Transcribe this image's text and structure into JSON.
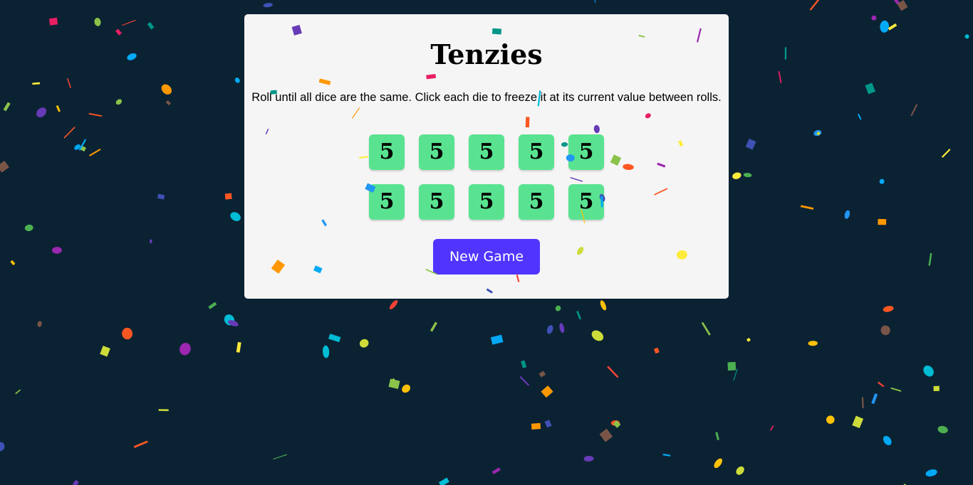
{
  "game": {
    "title": "Tenzies",
    "instructions": "Roll until all dice are the same. Click each die to freeze it at its current value between rolls.",
    "dice": [
      {
        "value": "5",
        "held": true
      },
      {
        "value": "5",
        "held": true
      },
      {
        "value": "5",
        "held": true
      },
      {
        "value": "5",
        "held": true
      },
      {
        "value": "5",
        "held": true
      },
      {
        "value": "5",
        "held": true
      },
      {
        "value": "5",
        "held": true
      },
      {
        "value": "5",
        "held": true
      },
      {
        "value": "5",
        "held": true
      },
      {
        "value": "5",
        "held": true
      }
    ],
    "button_label": "New Game",
    "state": "won"
  },
  "colors": {
    "background": "#0b2233",
    "board": "#f5f5f5",
    "die_held": "#59e391",
    "button": "#5035ff",
    "button_text": "#ffffff"
  },
  "confetti": {
    "active": true,
    "palette": [
      "#f44336",
      "#e91e63",
      "#9c27b0",
      "#673ab7",
      "#3f51b5",
      "#2196f3",
      "#03a9f4",
      "#00bcd4",
      "#009688",
      "#4caf50",
      "#8bc34a",
      "#cddc39",
      "#ffeb3b",
      "#ffc107",
      "#ff9800",
      "#ff5722",
      "#795548"
    ]
  }
}
